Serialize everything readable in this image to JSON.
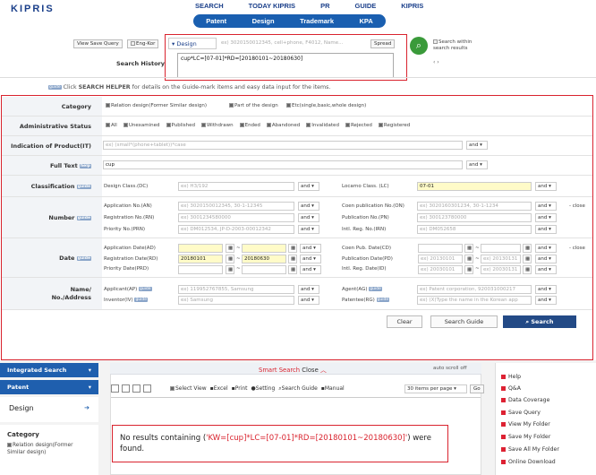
{
  "logo": "KIPRIS",
  "topnav": [
    "SEARCH",
    "TODAY KIPRIS",
    "PR",
    "GUIDE",
    "KIPRIS"
  ],
  "subnav": [
    "Patent",
    "Design",
    "Trademark",
    "KPA"
  ],
  "search": {
    "view_saved": "View Save Query",
    "eng_kor": "Eng-Kor",
    "category": "Design",
    "placeholder": "ex) 3020150012345, cell+phone, F4012, Name...",
    "spread": "Spread",
    "query": "cup*LC=[07-01]*RD=[20180101~20180630]",
    "history_label": "Search History",
    "search_within": "Search within search results"
  },
  "helper": {
    "badge": "guide",
    "prefix": "Click",
    "name": "SEARCH HELPER",
    "suffix": "for details on the Guide-mark items and easy data input for the items."
  },
  "category": {
    "label": "Category",
    "options": [
      {
        "t": "Relation design(Former Similar design)",
        "on": true
      },
      {
        "t": "Part of the design",
        "on": true
      },
      {
        "t": "Etc(single,basic,whole design)",
        "on": true
      }
    ]
  },
  "admin": {
    "label": "Administrative Status",
    "options": [
      "All",
      "Unexamined",
      "Published",
      "Withdrawn",
      "Ended",
      "Abandoned",
      "Invalidated",
      "Rejected",
      "Registered"
    ]
  },
  "product": {
    "label": "Indication of Product(IT)",
    "placeholder": "ex) (small*(phone+tablet))*case",
    "op": "and"
  },
  "fulltext": {
    "label": "Full Text",
    "help": "help",
    "value": "cup",
    "op": "and"
  },
  "classification": {
    "label": "Classification",
    "badge": "guide",
    "dc_label": "Design Class.(DC)",
    "dc_ph": "ex) H3/192",
    "lc_label": "Locarno Class. (LC)",
    "lc_value": "07-01",
    "op": "and"
  },
  "number": {
    "label": "Number",
    "badge": "guide",
    "close": "close",
    "rows": [
      {
        "l": "Application No.(AN)",
        "ph": "ex) 3020150012345, 30-1-12345",
        "r": "Coen publication No.(ON)",
        "rph": "ex) 3020160301234, 30-1-1234"
      },
      {
        "l": "Registration No.(RN)",
        "ph": "ex) 3001234580000",
        "r": "Publication No.(PN)",
        "rph": "ex) 300123780000"
      },
      {
        "l": "Priority No.(PRN)",
        "ph": "ex) DM012534, JP-D-2003-00012342",
        "r": "Intl. Reg. No.(IRN)",
        "rph": "ex) DM052658"
      }
    ],
    "op": "and"
  },
  "date": {
    "label": "Date",
    "badge": "guide",
    "close": "close",
    "rows": [
      {
        "l": "Application Date(AD)",
        "from": "",
        "to": "",
        "r": "Coen Pub. Date(CD)",
        "rfrom": "",
        "rto": ""
      },
      {
        "l": "Registration Date(RD)",
        "from": "20180101",
        "to": "20180630",
        "r": "Publication Date(PD)",
        "rfrom": "ex) 20130101",
        "rto": "ex) 20130131"
      },
      {
        "l": "Priority Date(PRD)",
        "from": "",
        "to": "",
        "r": "Intl. Reg. Date(ID)",
        "rfrom": "ex) 20030101",
        "rto": "ex) 20030131"
      }
    ],
    "tilde": "~",
    "op": "and"
  },
  "name": {
    "label1": "Name/",
    "label2": "No./Address",
    "rows": [
      {
        "l": "Applicant(AP)",
        "badge": "guide",
        "ph": "ex) 119952767855, Samsung",
        "r": "Agent(AG)",
        "rbadge": "guide",
        "rph": "ex) Patent corporation, 920031000217"
      },
      {
        "l": "Inventor(IV)",
        "badge": "guide",
        "ph": "ex) Samsung",
        "r": "Patentee(RG)",
        "rbadge": "guide",
        "rph": "ex) (X)Type the name in the Korean app"
      }
    ],
    "op": "and"
  },
  "actions": {
    "clear": "Clear",
    "guide": "Search Guide",
    "search": "Search"
  },
  "sidebar": {
    "integrated": "Integrated Search",
    "patent": "Patent",
    "design": "Design",
    "arrow": "➔",
    "cat_title": "Category",
    "cat_item": "Relation design(Former Similar design)"
  },
  "results": {
    "smart_prefix": "Smart Search",
    "smart_close": "Close",
    "autoscroll": "auto scroll off",
    "toolbar": [
      "Select View",
      "Excel",
      "Print",
      "Setting",
      "Search Guide",
      "Manual"
    ],
    "per_page": "30 items per page",
    "go": "Go",
    "noresult_a": "No results containing (",
    "noresult_q": "'KW=[cup]*LC=[07-01]*RD=[20180101~20180630]'",
    "noresult_b": ") were found."
  },
  "right_links": [
    "Help",
    "Q&A",
    "Data Coverage",
    "Save Query",
    "View My Folder",
    "Save My Folder",
    "Save All My Folder",
    "Online Download"
  ]
}
